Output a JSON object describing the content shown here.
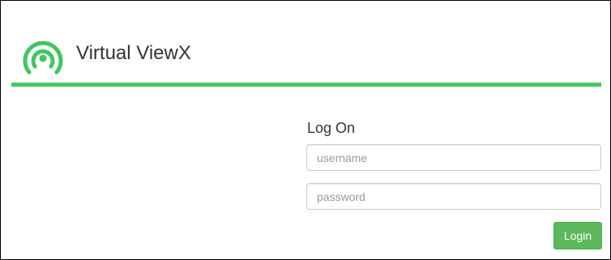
{
  "app": {
    "title": "Virtual ViewX",
    "logo_icon": "wireless-signal-icon",
    "accent_color": "#44c560"
  },
  "login": {
    "heading": "Log On",
    "username": {
      "value": "",
      "placeholder": "username"
    },
    "password": {
      "value": "",
      "placeholder": "password"
    },
    "submit_label": "Login",
    "submit_color": "#5cb85c"
  }
}
